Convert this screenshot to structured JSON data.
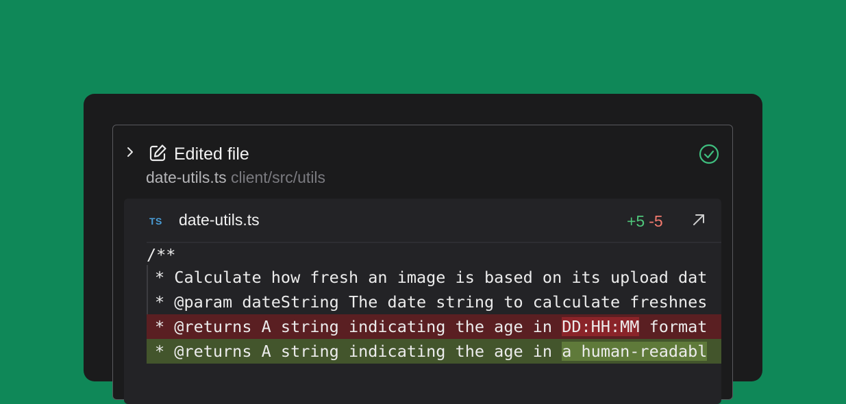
{
  "header": {
    "title": "Edited file",
    "file_name": "date-utils.ts",
    "file_dir": "client/src/utils"
  },
  "diff": {
    "lang_badge": "TS",
    "file_name": "date-utils.ts",
    "additions": "+5",
    "deletions": "-5",
    "lines": [
      {
        "type": "plain",
        "text": "/**"
      },
      {
        "type": "context",
        "text": "* Calculate how fresh an image is based on its upload dat"
      },
      {
        "type": "context",
        "text": "* @param dateString The date string to calculate freshnes"
      },
      {
        "type": "removed",
        "before": "* @returns A string indicating the age in ",
        "highlight": "DD:HH:MM",
        "after": " format"
      },
      {
        "type": "added",
        "before": "* @returns A string indicating the age in ",
        "highlight": "a human-readabl",
        "after": ""
      }
    ]
  },
  "colors": {
    "background": "#0f8858",
    "window": "#1b1b1c",
    "success": "#3fbf7f",
    "addition": "#4fc67a",
    "deletion": "#f27a6e",
    "ts_badge": "#4a9ed8"
  },
  "icons": [
    "chevron-right-icon",
    "edit-icon",
    "check-circle-icon",
    "typescript-icon",
    "open-external-icon"
  ]
}
